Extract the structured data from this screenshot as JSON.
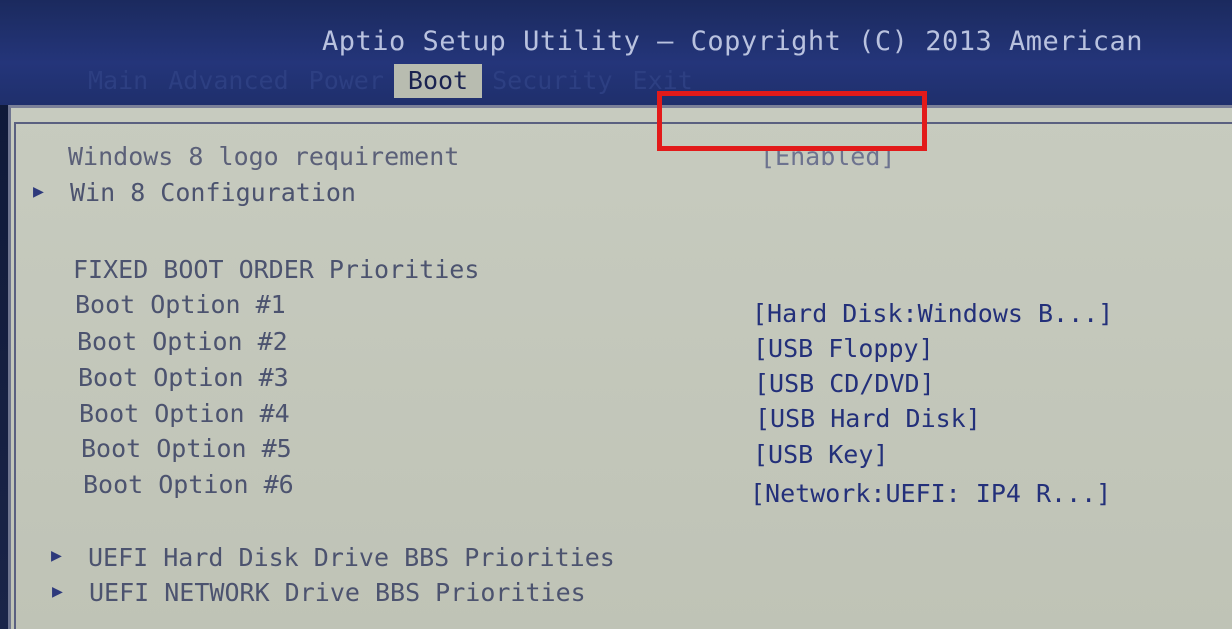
{
  "header": {
    "title": "Aptio Setup Utility – Copyright (C) 2013 American"
  },
  "tabs": [
    {
      "label": "Main",
      "active": false
    },
    {
      "label": "Advanced",
      "active": false
    },
    {
      "label": "Power",
      "active": false
    },
    {
      "label": "Boot",
      "active": true
    },
    {
      "label": "Security",
      "active": false
    },
    {
      "label": "Exit",
      "active": false
    }
  ],
  "settings": {
    "win8_logo": {
      "label": "Windows 8 logo requirement",
      "value": "[Enabled]"
    },
    "win8_config": {
      "label": "Win 8 Configuration"
    },
    "fixed_boot_heading": "FIXED BOOT ORDER Priorities",
    "boot_options": [
      {
        "label": "Boot Option #1",
        "value": "[Hard Disk:Windows B...]"
      },
      {
        "label": "Boot Option #2",
        "value": "[USB Floppy]"
      },
      {
        "label": "Boot Option #3",
        "value": "[USB CD/DVD]"
      },
      {
        "label": "Boot Option #4",
        "value": "[USB Hard Disk]"
      },
      {
        "label": "Boot Option #5",
        "value": "[USB Key]"
      },
      {
        "label": "Boot Option #6",
        "value": "[Network:UEFI: IP4 R...]"
      }
    ],
    "submenus": [
      {
        "label": "UEFI Hard Disk Drive BBS Priorities"
      },
      {
        "label": "UEFI NETWORK Drive BBS Priorities"
      }
    ]
  },
  "colors": {
    "header_bg": "#24357a",
    "panel_bg": "#c7cbbf",
    "highlight": "#e21a1a",
    "value_text": "#23307a"
  },
  "icons": {
    "submenu_arrow": "triangle-right"
  }
}
